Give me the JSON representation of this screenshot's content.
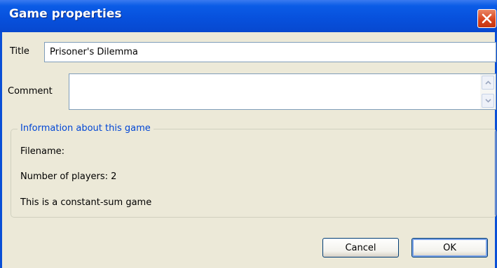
{
  "window": {
    "title": "Game properties",
    "close_icon": "close-icon"
  },
  "form": {
    "title_label": "Title",
    "title_value": "Prisoner's Dilemma",
    "comment_label": "Comment",
    "comment_value": ""
  },
  "info": {
    "legend": "Information about this game",
    "filename_line": "Filename:",
    "players_line": "Number of players: 2",
    "constant_sum_line": "This is a constant-sum game"
  },
  "buttons": {
    "cancel_label": "Cancel",
    "ok_label": "OK"
  },
  "colors": {
    "titlebar": "#0751dd",
    "dialog_background": "#ece9d8",
    "legend_text": "#0046d5",
    "close_button": "#d9461f"
  }
}
